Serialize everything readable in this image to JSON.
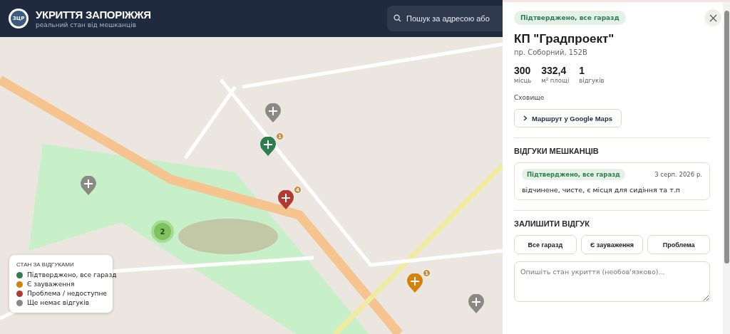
{
  "header": {
    "logo_text": "ЗЦР",
    "title": "УКРИТТЯ ЗАПОРІЖЖЯ",
    "subtitle": "реальний стан від мешканців",
    "search": {
      "placeholder": "Пошук за адресою або"
    }
  },
  "markers": [
    {
      "kind": "pin",
      "color": "#8a8a85"
    },
    {
      "kind": "pin",
      "color": "#2e7d4f",
      "count": "1"
    },
    {
      "kind": "pin",
      "color": "#b23a30",
      "count": "4"
    },
    {
      "kind": "pin",
      "color": "#8a8a85"
    },
    {
      "kind": "pin",
      "color": "#d4820a",
      "count": "1"
    },
    {
      "kind": "pin",
      "color": "#8a8a85"
    },
    {
      "kind": "cluster",
      "count": "2"
    }
  ],
  "legend": {
    "title": "СТАН ЗА ВІДГУКАМИ",
    "items": [
      {
        "label": "Підтверджено, все гаразд",
        "color": "#2e7d4f"
      },
      {
        "label": "Є зауваження",
        "color": "#d4820a"
      },
      {
        "label": "Проблема / недоступне",
        "color": "#b23a30"
      },
      {
        "label": "Ще немає відгуків",
        "color": "#8a8a85"
      }
    ]
  },
  "panel": {
    "status_badge": "Підтверджено, все гаразд",
    "name": "КП \"Градпроект\"",
    "address": "пр. Соборний, 152В",
    "stats": [
      {
        "value": "300",
        "label": "місць"
      },
      {
        "value": "332,4",
        "label": "м² площі"
      },
      {
        "value": "1",
        "label": "відгуків"
      }
    ],
    "type": "Сховище",
    "route_button": "Маршрут у Google Maps",
    "reviews_title": "ВІДГУКИ МЕШКАНЦІВ",
    "reviews": [
      {
        "badge": "Підтверджено, все гаразд",
        "date": "3 серп. 2026 р.",
        "text": "відчинене, чисте, є місця для сидіння та т.п"
      }
    ],
    "leave_title": "ЗАЛИШИТИ ВІДГУК",
    "options": [
      {
        "label": "Все гаразд",
        "selected": false
      },
      {
        "label": "Є зауваження",
        "selected": false
      },
      {
        "label": "Проблема",
        "selected": false
      }
    ],
    "comment": {
      "placeholder": "Опишіть стан укриття (необов'язково)..."
    }
  }
}
